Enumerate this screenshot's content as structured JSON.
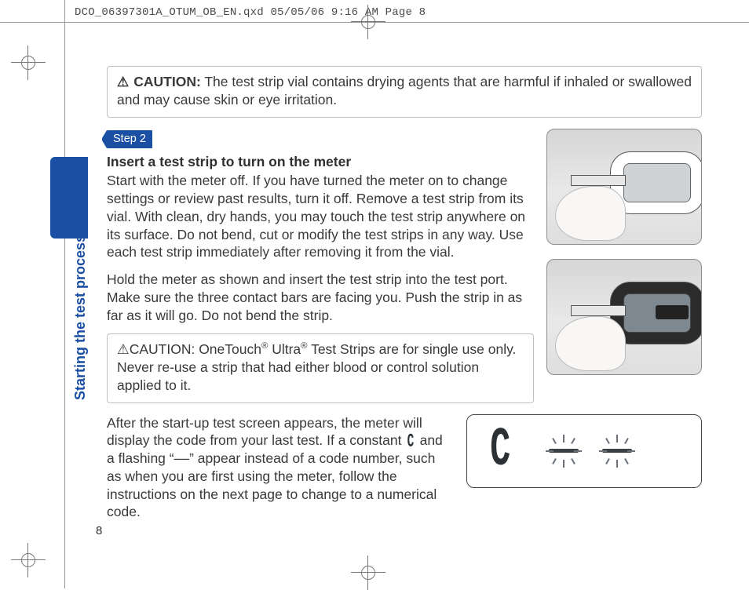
{
  "print_slug": "DCO_06397301A_OTUM_OB_EN.qxd  05/05/06  9:16 AM  Page 8",
  "page_number": "8",
  "sidebar_label": "Starting the test process",
  "caution1_lead": "CAUTION:",
  "caution1_text": " The test strip vial contains drying agents that are harmful if inhaled or swallowed and may cause skin or eye irritation.",
  "step_tag": "Step 2",
  "step_heading": "Insert a test strip to turn on the meter",
  "para1": "Start with the meter off. If you have turned the meter on to change settings or review past results, turn it off. Remove a test strip from its vial. With clean, dry hands, you may touch the test strip anywhere on its surface. Do not bend, cut or modify the test strips in any way. Use each test strip immediately after removing it from the vial.",
  "para2": "Hold the meter as shown and insert the test strip into the test port. Make sure the three contact bars are facing you. Push the strip in as far as it will go. Do not bend the strip.",
  "caution2_lead": "CAUTION:",
  "caution2_text_pre": " OneTouch",
  "caution2_text_mid": " Ultra",
  "caution2_text_post": " Test Strips are for single use only. Never re-use a strip that had either blood or control solution applied to it.",
  "para3_pre": "After the start-up test screen appears, the meter will display the code from your last test. If a constant ",
  "para3_c": "C",
  "para3_mid": " and a flashing “––” appear instead of a code number, such as when you are first using the meter, follow the instructions on the next page to change to a numerical code.",
  "lcd_c": "C",
  "reg_sup": "®",
  "warn_glyph": "⚠"
}
